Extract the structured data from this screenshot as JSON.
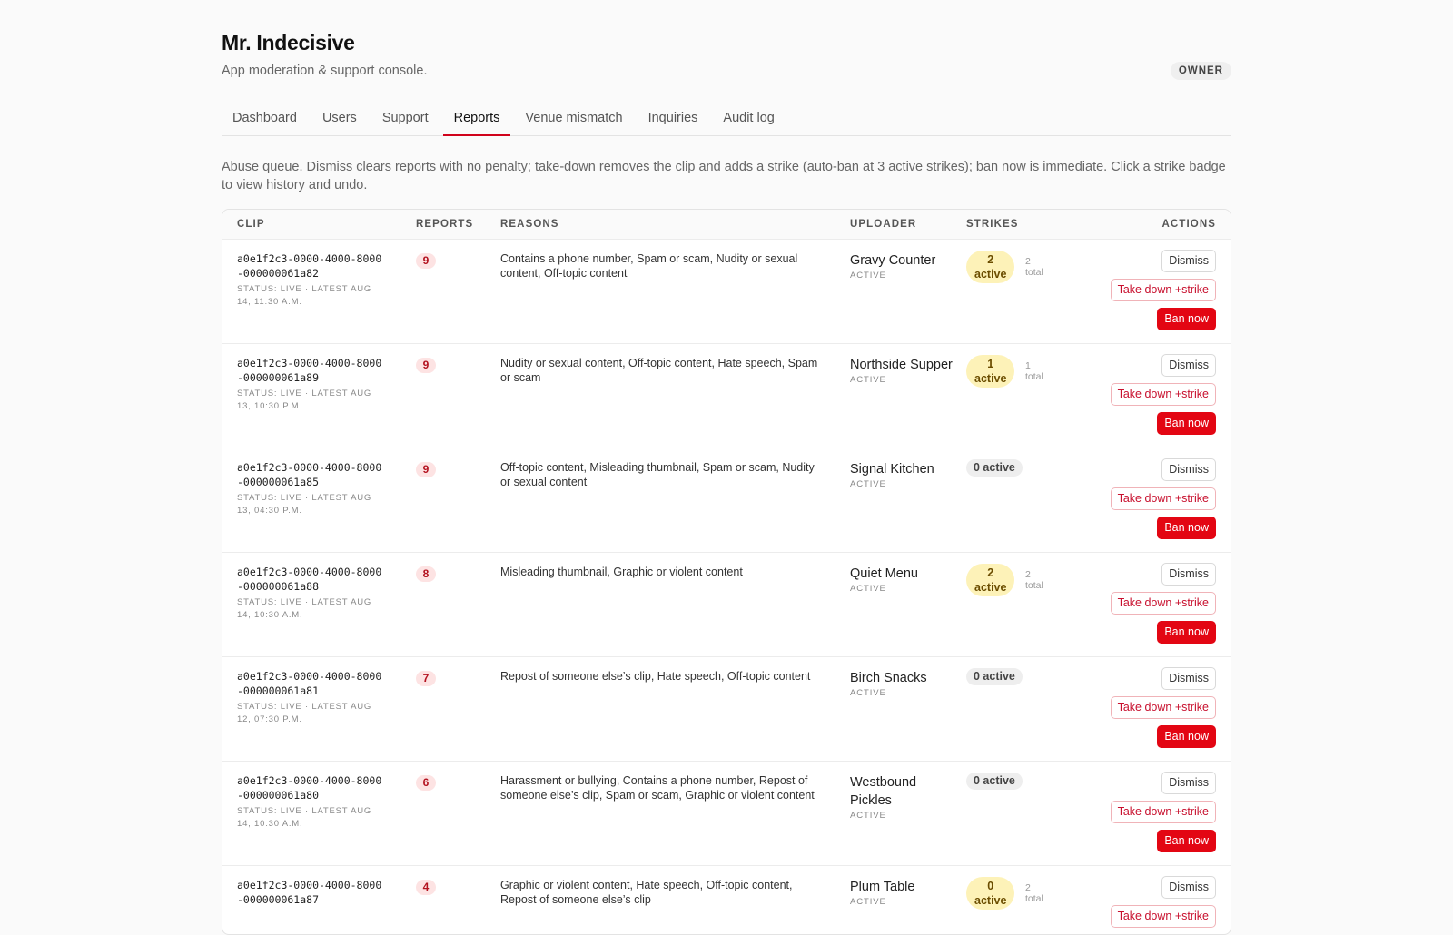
{
  "app": {
    "title": "Mr. Indecisive",
    "subtitle": "App moderation & support console.",
    "role": "OWNER"
  },
  "tabs": [
    "Dashboard",
    "Users",
    "Support",
    "Reports",
    "Venue mismatch",
    "Inquiries",
    "Audit log"
  ],
  "active_tab": "Reports",
  "intro": "Abuse queue. Dismiss clears reports with no penalty; take-down removes the clip and adds a strike (auto-ban at 3 active strikes); ban now is immediate. Click a strike badge to view history and undo.",
  "columns": {
    "clip": "CLIP",
    "reports": "REPORTS",
    "reasons": "REASONS",
    "uploader": "UPLOADER",
    "strikes": "STRIKES",
    "actions": "ACTIONS"
  },
  "buttons": {
    "dismiss": "Dismiss",
    "take_down": "Take down +strike",
    "ban": "Ban now"
  },
  "rows": [
    {
      "clip_id": "a0e1f2c3-0000-4000-8000-000000061a82",
      "status": "STATUS: LIVE · LATEST AUG 14, 11:30 A.M.",
      "reports": "9",
      "reasons": "Contains a phone number, Spam or scam, Nudity or sexual content, Off-topic content",
      "uploader": "Gravy Counter",
      "uploader_status": "ACTIVE",
      "strikes_active": "2",
      "strikes_label": "active",
      "strikes_total": "2",
      "total_label": "total"
    },
    {
      "clip_id": "a0e1f2c3-0000-4000-8000-000000061a89",
      "status": "STATUS: LIVE · LATEST AUG 13, 10:30 P.M.",
      "reports": "9",
      "reasons": "Nudity or sexual content, Off-topic content, Hate speech, Spam or scam",
      "uploader": "Northside Supper",
      "uploader_status": "ACTIVE",
      "strikes_active": "1",
      "strikes_label": "active",
      "strikes_total": "1",
      "total_label": "total"
    },
    {
      "clip_id": "a0e1f2c3-0000-4000-8000-000000061a85",
      "status": "STATUS: LIVE · LATEST AUG 13, 04:30 P.M.",
      "reports": "9",
      "reasons": "Off-topic content, Misleading thumbnail, Spam or scam, Nudity or sexual content",
      "uploader": "Signal Kitchen",
      "uploader_status": "ACTIVE",
      "strikes_zero": "0 active"
    },
    {
      "clip_id": "a0e1f2c3-0000-4000-8000-000000061a88",
      "status": "STATUS: LIVE · LATEST AUG 14, 10:30 A.M.",
      "reports": "8",
      "reasons": "Misleading thumbnail, Graphic or violent content",
      "uploader": "Quiet Menu",
      "uploader_status": "ACTIVE",
      "strikes_active": "2",
      "strikes_label": "active",
      "strikes_total": "2",
      "total_label": "total"
    },
    {
      "clip_id": "a0e1f2c3-0000-4000-8000-000000061a81",
      "status": "STATUS: LIVE · LATEST AUG 12, 07:30 P.M.",
      "reports": "7",
      "reasons": "Repost of someone else’s clip, Hate speech, Off-topic content",
      "uploader": "Birch Snacks",
      "uploader_status": "ACTIVE",
      "strikes_zero": "0 active"
    },
    {
      "clip_id": "a0e1f2c3-0000-4000-8000-000000061a80",
      "status": "STATUS: LIVE · LATEST AUG 14, 10:30 A.M.",
      "reports": "6",
      "reasons": "Harassment or bullying, Contains a phone number, Repost of someone else’s clip, Spam or scam, Graphic or violent content",
      "uploader": "Westbound Pickles",
      "uploader_status": "ACTIVE",
      "strikes_zero": "0 active"
    },
    {
      "clip_id": "a0e1f2c3-0000-4000-8000-000000061a87",
      "status": "",
      "reports": "4",
      "reasons": "Graphic or violent content, Hate speech, Off-topic content, Repost of someone else’s clip",
      "uploader": "Plum Table",
      "uploader_status": "ACTIVE",
      "strikes_active": "0",
      "strikes_label": "active",
      "strikes_total": "2",
      "total_label": "total"
    }
  ]
}
